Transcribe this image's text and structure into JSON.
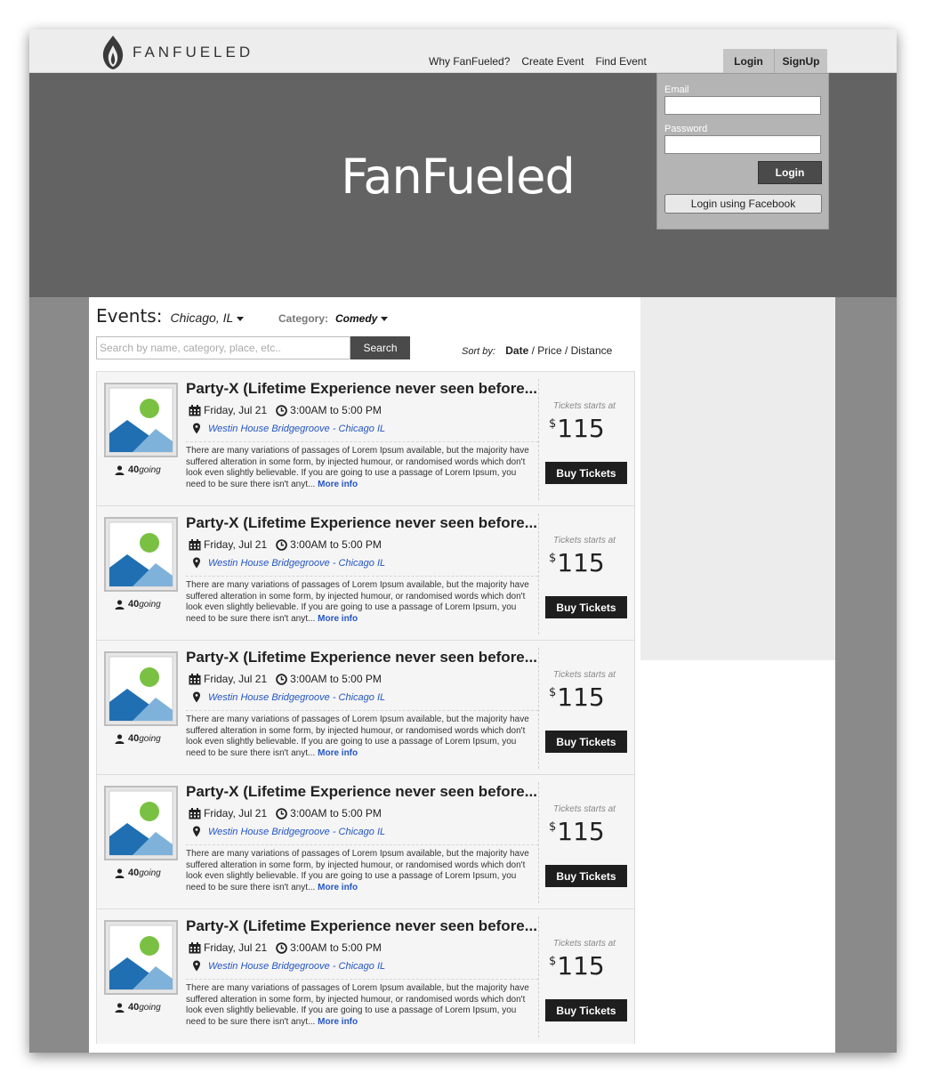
{
  "brand": {
    "name": "FANFUELED"
  },
  "nav": {
    "items": [
      "Why FanFueled?",
      "Create Event",
      "Find Event"
    ]
  },
  "auth": {
    "login_tab": "Login",
    "signup_tab": "SignUp"
  },
  "hero": {
    "title": "FanFueled"
  },
  "login_panel": {
    "email_label": "Email",
    "password_label": "Password",
    "login_button": "Login",
    "facebook_button": "Login using Facebook"
  },
  "events": {
    "title": "Events:",
    "city": "Chicago, IL",
    "category_label": "Category:",
    "category_value": "Comedy",
    "search_placeholder": "Search by name, category, place, etc..",
    "search_button": "Search",
    "sort_label": "Sort by:",
    "sort_options": [
      "Date",
      "Price",
      "Distance"
    ],
    "sort_active": "Date"
  },
  "items": [
    {
      "title": "Party-X (Lifetime Experience never seen before...",
      "date": "Friday, Jul 21",
      "time": "3:00AM to 5:00 PM",
      "venue": "Westin House Bridgegroove - Chicago IL",
      "description": "There are many variations of passages of Lorem Ipsum available, but the majority have suffered alteration in some form, by injected humour, or randomised words which don't look even slightly believable. If you are going to use a passage of Lorem Ipsum, you need to be sure there isn't anyt...",
      "more": "More info",
      "going_count": "40",
      "going_word": "going",
      "tickets_label": "Tickets starts at",
      "currency": "$",
      "price": "115",
      "buy": "Buy Tickets"
    },
    {
      "title": "Party-X (Lifetime Experience never seen before...",
      "date": "Friday, Jul 21",
      "time": "3:00AM to 5:00 PM",
      "venue": "Westin House Bridgegroove - Chicago IL",
      "description": "There are many variations of passages of Lorem Ipsum available, but the majority have suffered alteration in some form, by injected humour, or randomised words which don't look even slightly believable. If you are going to use a passage of Lorem Ipsum, you need to be sure there isn't anyt...",
      "more": "More info",
      "going_count": "40",
      "going_word": "going",
      "tickets_label": "Tickets starts at",
      "currency": "$",
      "price": "115",
      "buy": "Buy Tickets"
    },
    {
      "title": "Party-X (Lifetime Experience never seen before...",
      "date": "Friday, Jul 21",
      "time": "3:00AM to 5:00 PM",
      "venue": "Westin House Bridgegroove - Chicago IL",
      "description": "There are many variations of passages of Lorem Ipsum available, but the majority have suffered alteration in some form, by injected humour, or randomised words which don't look even slightly believable. If you are going to use a passage of Lorem Ipsum, you need to be sure there isn't anyt...",
      "more": "More info",
      "going_count": "40",
      "going_word": "going",
      "tickets_label": "Tickets starts at",
      "currency": "$",
      "price": "115",
      "buy": "Buy Tickets"
    },
    {
      "title": "Party-X (Lifetime Experience never seen before...",
      "date": "Friday, Jul 21",
      "time": "3:00AM to 5:00 PM",
      "venue": "Westin House Bridgegroove - Chicago IL",
      "description": "There are many variations of passages of Lorem Ipsum available, but the majority have suffered alteration in some form, by injected humour, or randomised words which don't look even slightly believable. If you are going to use a passage of Lorem Ipsum, you need to be sure there isn't anyt...",
      "more": "More info",
      "going_count": "40",
      "going_word": "going",
      "tickets_label": "Tickets starts at",
      "currency": "$",
      "price": "115",
      "buy": "Buy Tickets"
    },
    {
      "title": "Party-X (Lifetime Experience never seen before...",
      "date": "Friday, Jul 21",
      "time": "3:00AM to 5:00 PM",
      "venue": "Westin House Bridgegroove - Chicago IL",
      "description": "There are many variations of passages of Lorem Ipsum available, but the majority have suffered alteration in some form, by injected humour, or randomised words which don't look even slightly believable. If you are going to use a passage of Lorem Ipsum, you need to be sure there isn't anyt...",
      "more": "More info",
      "going_count": "40",
      "going_word": "going",
      "tickets_label": "Tickets starts at",
      "currency": "$",
      "price": "115",
      "buy": "Buy Tickets"
    }
  ],
  "icons": [
    "flame-logo-icon",
    "calendar-icon",
    "clock-icon",
    "map-pin-icon",
    "user-icon",
    "image-placeholder-icon",
    "caret-down-icon"
  ],
  "colors": {
    "header_bg": "#ededed",
    "hero_bg": "#636363",
    "page_bg": "#8a8a8a",
    "link": "#2455c3",
    "button_dark": "#1e1e1e"
  }
}
